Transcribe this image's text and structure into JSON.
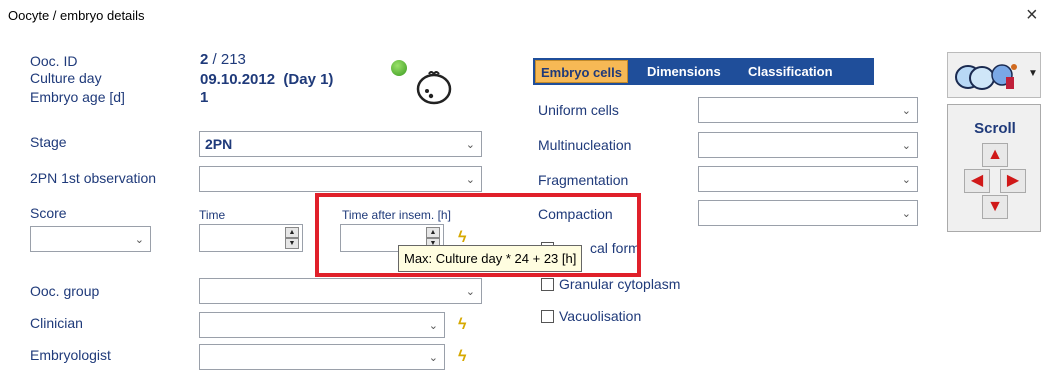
{
  "window": {
    "title": "Oocyte / embryo details",
    "close_glyph": "×"
  },
  "left": {
    "ooc_id_label": "Ooc. ID",
    "ooc_id_value": "2",
    "ooc_id_total": " / 213",
    "culture_day_label": "Culture day",
    "culture_day_value": "09.10.2012  (Day 1)",
    "embryo_age_label": "Embryo age [d]",
    "embryo_age_value": "1",
    "stage_label": "Stage",
    "stage_value": "2PN",
    "pn1_label": "2PN 1st observation",
    "pn1_value": "",
    "score_label": "Score",
    "score_value": "",
    "time_label": "Time",
    "time_value": "",
    "time_after_label": "Time after insem. [h]",
    "time_after_value": "",
    "ooc_group_label": "Ooc. group",
    "ooc_group_value": "",
    "clinician_label": "Clinician",
    "clinician_value": "",
    "embryologist_label": "Embryologist",
    "embryologist_value": ""
  },
  "tooltip": {
    "text": "Max: Culture day * 24 + 23 [h]"
  },
  "tabs": [
    {
      "label": "Embryo cells",
      "active": true
    },
    {
      "label": "Dimensions",
      "active": false
    },
    {
      "label": "Classification",
      "active": false
    }
  ],
  "embryo_cells": {
    "uniform_cells_label": "Uniform cells",
    "multinucleation_label": "Multinucleation",
    "fragmentation_label": "Fragmentation",
    "compaction_label": "Compaction",
    "anatomical_form_label": "Anatomical form",
    "anatomical_form_visible": "cal form",
    "granular_cytoplasm_label": "Granular cytoplasm",
    "vacuolisation_label": "Vacuolisation"
  },
  "scroll": {
    "title": "Scroll",
    "up": "🡅",
    "left": "🡄",
    "right": "🡆",
    "down": "🡇"
  },
  "colors": {
    "label": "#1f3a7a",
    "tab_bar": "#1f4e9a",
    "tab_active": "#f7b955",
    "highlight": "#e0202a",
    "status_dot": "#5cb832"
  },
  "icons": [
    "status-dot-icon",
    "embryo-icon",
    "people-icon",
    "dropdown-arrow-icon",
    "lightning-icon"
  ]
}
